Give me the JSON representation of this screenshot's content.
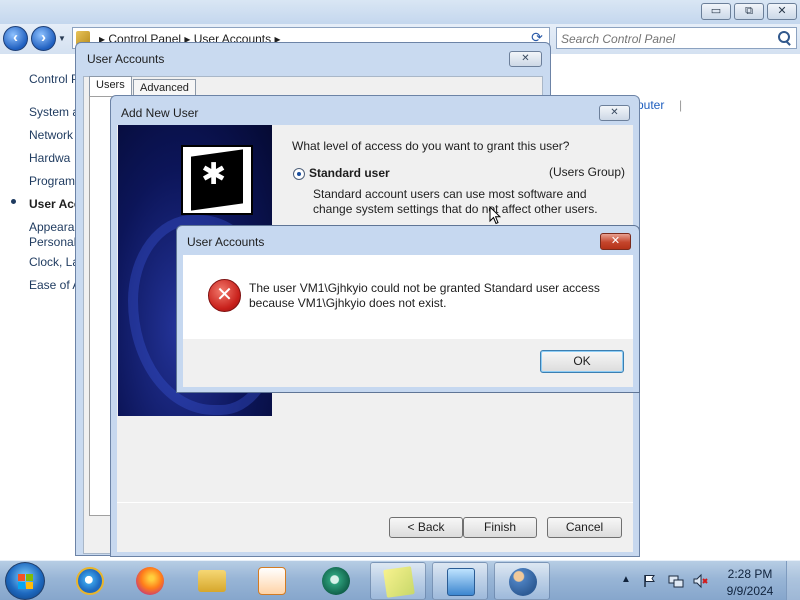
{
  "control_panel": {
    "breadcrumb": "▸  Control Panel  ▸  User Accounts  ▸",
    "search_placeholder": "Search Control Panel",
    "sidebar_items": [
      "Control P",
      "System a",
      "Network",
      "Hardwa",
      "Program",
      "User Acc",
      "Appeara",
      "Personal",
      "Clock, La",
      "Ease of A"
    ],
    "right_link": "puter",
    "window_min_glyph": "▭",
    "window_max_glyph": "⧉",
    "window_close_glyph": "✕"
  },
  "user_accounts_dialog": {
    "title": "User Accounts",
    "tabs": [
      "Users",
      "Advanced"
    ],
    "close_glyph": "✕"
  },
  "wizard": {
    "title": "Add New User",
    "question": "What level of access do you want to grant this user?",
    "option_label": "Standard user",
    "option_group": "(Users Group)",
    "option_description": "Standard account users can use most software and change system settings that do not affect other users.",
    "buttons": {
      "back": "< Back",
      "finish": "Finish",
      "cancel": "Cancel"
    },
    "close_glyph": "✕",
    "icon_glyph": "✱"
  },
  "error_dialog": {
    "title": "User Accounts",
    "message": "The user VM1\\Gjhkyio could not be granted Standard user access because VM1\\Gjhkyio does not exist.",
    "ok_label": "OK",
    "close_glyph": "✕",
    "icon_glyph": "✕"
  },
  "taskbar": {
    "time": "2:28 PM",
    "date": "9/9/2024",
    "tray_expand_glyph": "▲",
    "apps": [
      "internet-explorer",
      "firefox",
      "file-explorer",
      "media-player",
      "app-green-circle",
      "sticky-notes",
      "control-panel",
      "user-accounts"
    ]
  },
  "colors": {
    "accent_blue": "#1f5fbf",
    "error_red": "#c8201b",
    "taskbar": "#98b5d6"
  }
}
